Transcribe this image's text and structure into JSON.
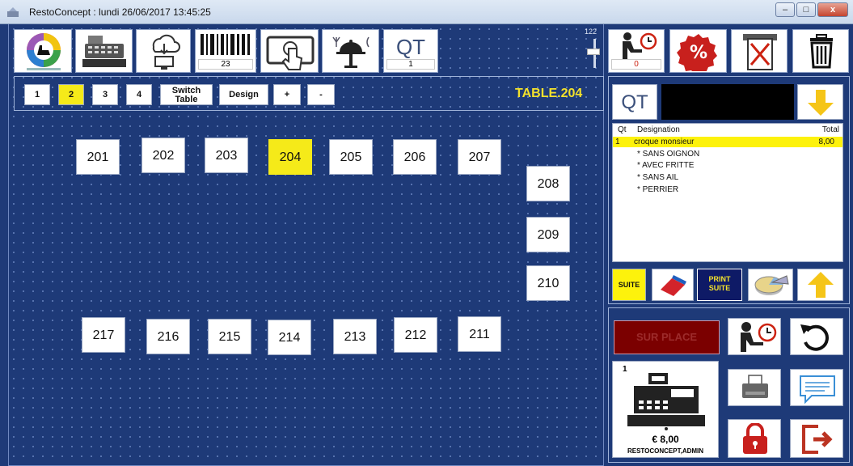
{
  "window": {
    "title": "RestoConcept : lundi 26/06/2017 13:45:25",
    "minimize": "–",
    "maximize": "□",
    "close": "x"
  },
  "toolbar": {
    "barcode_count": "23",
    "qt_label": "QT",
    "qt_count": "1",
    "slider_value": "122",
    "waiter_count": "0"
  },
  "tabs": {
    "t1": "1",
    "t2": "2",
    "t3": "3",
    "t4": "4",
    "switch_line1": "Switch",
    "switch_line2": "Table",
    "design": "Design",
    "plus": "+",
    "minus": "-"
  },
  "current_table": "TABLE.204",
  "tables": {
    "t201": "201",
    "t202": "202",
    "t203": "203",
    "t204": "204",
    "t205": "205",
    "t206": "206",
    "t207": "207",
    "t208": "208",
    "t209": "209",
    "t210": "210",
    "t211": "211",
    "t212": "212",
    "t213": "213",
    "t214": "214",
    "t215": "215",
    "t216": "216",
    "t217": "217"
  },
  "order": {
    "qt_label": "QT",
    "header_qt": "Qt",
    "header_designation": "Designation",
    "header_total": "Total",
    "item_qty": "1",
    "item_name": "croque monsieur",
    "item_total": "8,00",
    "mods": [
      "* SANS OIGNON",
      "* AVEC FRITTE",
      "* SANS AIL",
      "* PERRIER"
    ]
  },
  "actions": {
    "suite": "SUITE",
    "print_suite_1": "PRINT",
    "print_suite_2": "SUITE",
    "sur_place": "SUR PLACE"
  },
  "register": {
    "qty": "1",
    "amount": "€ 8,00",
    "user": "RESTOCONCEPT,ADMIN"
  },
  "colors": {
    "background": "#1e3a78",
    "selected": "#f5ea19",
    "table_label": "#f3e12c",
    "sur_place_bg": "#7b0000"
  }
}
